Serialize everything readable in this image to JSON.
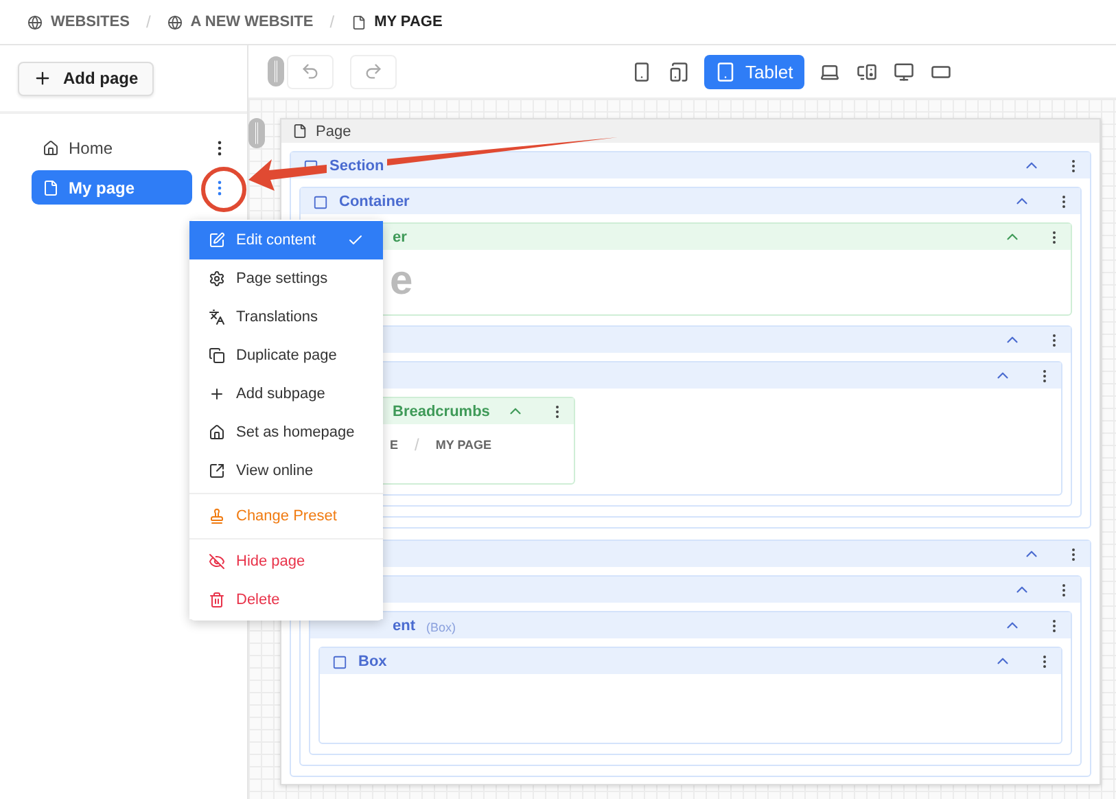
{
  "breadcrumb": {
    "separator": "/",
    "items": [
      {
        "label": "WEBSITES",
        "kind": "globe"
      },
      {
        "label": "A NEW WEBSITE",
        "kind": "globe"
      },
      {
        "label": "MY PAGE",
        "kind": "page"
      }
    ]
  },
  "sidebar": {
    "add_button": "Add page",
    "pages": [
      {
        "label": "Home",
        "kind": "home",
        "selected": false
      },
      {
        "label": "My page",
        "kind": "page",
        "selected": true
      }
    ]
  },
  "devices": [
    {
      "kind": "phone",
      "selected": false
    },
    {
      "kind": "phablet",
      "selected": false
    },
    {
      "kind": "tablet",
      "label": "Tablet",
      "selected": true
    },
    {
      "kind": "laptop",
      "selected": false
    },
    {
      "kind": "desktop",
      "selected": false
    },
    {
      "kind": "monitor",
      "selected": false
    },
    {
      "kind": "wide",
      "selected": false
    }
  ],
  "menu": [
    {
      "label": "Edit content",
      "kind": "edit",
      "warning": false,
      "danger": false,
      "selected": true
    },
    {
      "label": "Page settings",
      "kind": "settings",
      "warning": false,
      "danger": false,
      "selected": false
    },
    {
      "label": "Translations",
      "kind": "translate",
      "warning": false,
      "danger": false,
      "selected": false
    },
    {
      "label": "Duplicate page",
      "kind": "copy",
      "warning": false,
      "danger": false,
      "selected": false
    },
    {
      "label": "Add subpage",
      "kind": "add",
      "warning": false,
      "danger": false,
      "selected": false
    },
    {
      "label": "Set as homepage",
      "kind": "home",
      "warning": false,
      "danger": false,
      "selected": false
    },
    {
      "label": "View online",
      "kind": "external",
      "warning": false,
      "danger": false,
      "selected": false
    },
    {
      "label": "Change Preset",
      "kind": "preset",
      "warning": true,
      "danger": false,
      "selected": false
    },
    {
      "label": "Hide page",
      "kind": "hide",
      "warning": false,
      "danger": true,
      "selected": false
    },
    {
      "label": "Delete",
      "kind": "delete",
      "warning": false,
      "danger": true,
      "selected": false
    }
  ],
  "page": {
    "title": "Page",
    "blocks": [
      {
        "title": "Section",
        "kind": "layout",
        "children": [
          {
            "title": "Container",
            "kind": "layout",
            "children": [
              {
                "title": "er",
                "kind": "component",
                "content": {
                  "kind": "heading",
                  "text": "e"
                }
              },
              {
                "kind": "layout",
                "children": [
                  {
                    "kind": "layout",
                    "children": [
                      {
                        "title": "Breadcrumbs",
                        "kind": "component",
                        "narrow": true,
                        "content": {
                          "kind": "crumbs",
                          "separator": "/",
                          "items": [
                            "E",
                            "MY PAGE"
                          ]
                        }
                      }
                    ]
                  }
                ]
              }
            ]
          }
        ]
      },
      {
        "kind": "layout",
        "children": [
          {
            "kind": "layout",
            "children": [
              {
                "title": "ent",
                "note": "(Box)",
                "kind": "layout",
                "children": [
                  {
                    "title": "Box",
                    "kind": "layout",
                    "content": {
                      "kind": "empty"
                    }
                  }
                ]
              }
            ]
          }
        ]
      }
    ]
  }
}
